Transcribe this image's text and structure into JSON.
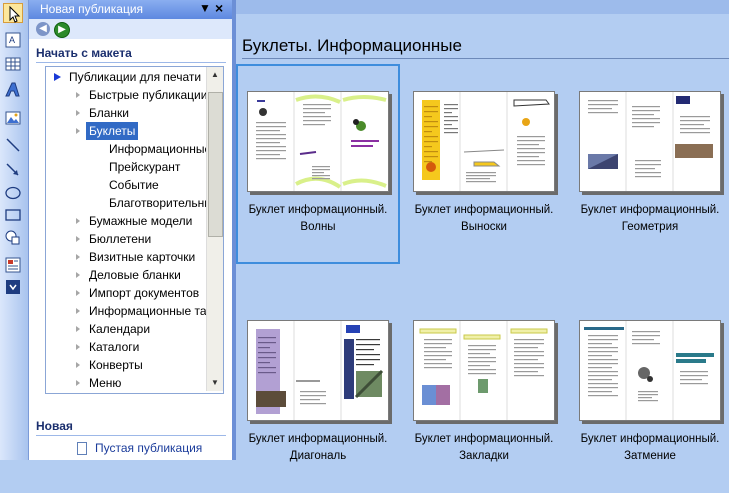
{
  "toolbar": {
    "tools": [
      "pointer-tool",
      "text-box-tool",
      "table-tool",
      "wordart-tool",
      "picture-tool",
      "line-tool",
      "arrow-tool",
      "oval-tool",
      "rectangle-tool",
      "autoshapes-tool",
      "design-gallery-tool",
      "more-tools"
    ]
  },
  "task_pane": {
    "title": "Новая публикация",
    "menu_glyph": "▼",
    "close_glyph": "×",
    "section_start": "Начать с макета",
    "tree": [
      {
        "label": "Публикации для печати",
        "arrow": "expanded",
        "level": 0
      },
      {
        "label": "Быстрые публикации",
        "arrow": "collapsed",
        "level": 1
      },
      {
        "label": "Бланки",
        "arrow": "collapsed",
        "level": 1
      },
      {
        "label": "Буклеты",
        "arrow": "collapsed",
        "level": 1,
        "selected": true
      },
      {
        "label": "Информационные",
        "arrow": "none",
        "level": 2
      },
      {
        "label": "Прейскурант",
        "arrow": "none",
        "level": 2
      },
      {
        "label": "Событие",
        "arrow": "none",
        "level": 2
      },
      {
        "label": "Благотворительные",
        "arrow": "none",
        "level": 2
      },
      {
        "label": "Бумажные модели",
        "arrow": "collapsed",
        "level": 1
      },
      {
        "label": "Бюллетени",
        "arrow": "collapsed",
        "level": 1
      },
      {
        "label": "Визитные карточки",
        "arrow": "collapsed",
        "level": 1
      },
      {
        "label": "Деловые бланки",
        "arrow": "collapsed",
        "level": 1
      },
      {
        "label": "Импорт документов",
        "arrow": "collapsed",
        "level": 1
      },
      {
        "label": "Информационные табло",
        "arrow": "collapsed",
        "level": 1
      },
      {
        "label": "Календари",
        "arrow": "collapsed",
        "level": 1
      },
      {
        "label": "Каталоги",
        "arrow": "collapsed",
        "level": 1
      },
      {
        "label": "Конверты",
        "arrow": "collapsed",
        "level": 1
      },
      {
        "label": "Меню",
        "arrow": "collapsed",
        "level": 1
      }
    ],
    "section_new": "Новая",
    "blank_link": "Пустая публикация"
  },
  "gallery": {
    "title": "Буклеты. Информационные",
    "items": [
      {
        "caption_line1": "Буклет информационный.",
        "caption_line2": "Волны",
        "style": "waves",
        "selected": true
      },
      {
        "caption_line1": "Буклет информационный.",
        "caption_line2": "Выноски",
        "style": "callouts",
        "selected": false
      },
      {
        "caption_line1": "Буклет информационный.",
        "caption_line2": "Геометрия",
        "style": "geometry",
        "selected": false
      },
      {
        "caption_line1": "Буклет информационный.",
        "caption_line2": "Диагональ",
        "style": "diagonal",
        "selected": false
      },
      {
        "caption_line1": "Буклет информационный.",
        "caption_line2": "Закладки",
        "style": "bookmarks",
        "selected": false
      },
      {
        "caption_line1": "Буклет информационный.",
        "caption_line2": "Затмение",
        "style": "eclipse",
        "selected": false
      }
    ]
  },
  "colors": {
    "selection": "#316ac5",
    "tile_highlight": "#3e8ddd",
    "background": "#b3cdf2"
  }
}
